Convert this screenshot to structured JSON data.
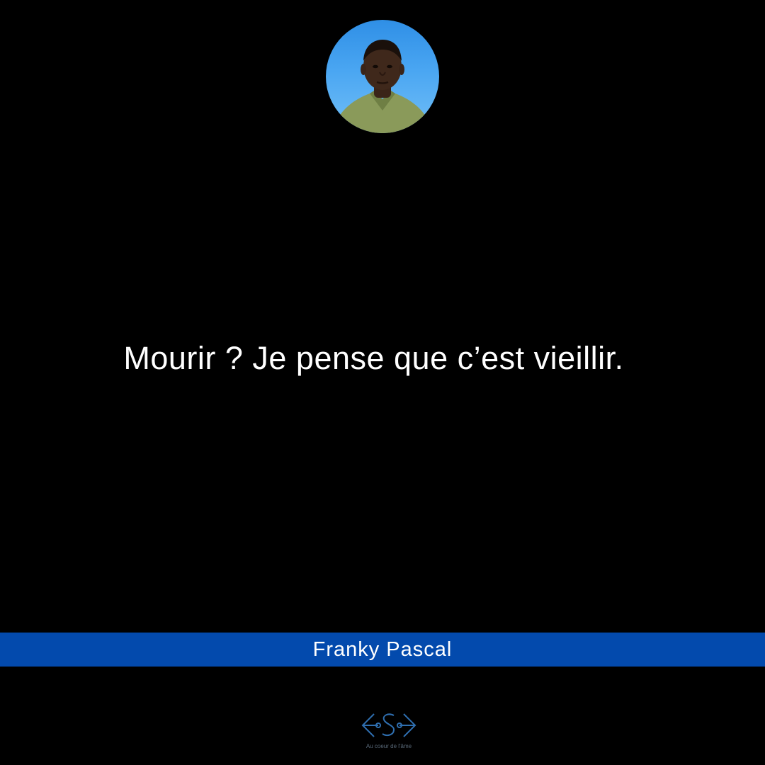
{
  "avatar": {
    "alt": "Franky Pascal"
  },
  "quote": {
    "text": "Mourir ? Je pense que c’est vieillir."
  },
  "author": {
    "name": "Franky Pascal",
    "band_color": "#034aad"
  },
  "logo": {
    "icon": "pen-nib-logo-icon",
    "caption": "Au coeur de l'âme"
  },
  "colors": {
    "background": "#000000",
    "text": "#ffffff",
    "accent": "#034aad"
  }
}
